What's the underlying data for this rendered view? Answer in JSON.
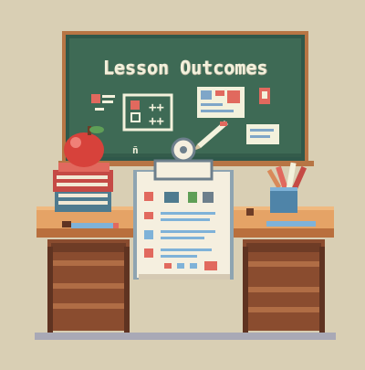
{
  "scene": {
    "board_title": "Lesson Outcomes",
    "board_mark": "ñ"
  },
  "colors": {
    "background": "#d9cfb4",
    "board_frame": "#b77544",
    "board_surface": "#3e6a55",
    "chalk": "#f3f1dc",
    "desk_top": "#e5a366",
    "desk_dark": "#8a4c2f",
    "apple_red": "#d7423b",
    "book_red": "#c54a45",
    "book_teal": "#4f7b8f",
    "cup_blue": "#4f84a8",
    "clipboard": "#8ea4b1",
    "paper": "#f5efdf",
    "floor": "#a9a9b6"
  }
}
